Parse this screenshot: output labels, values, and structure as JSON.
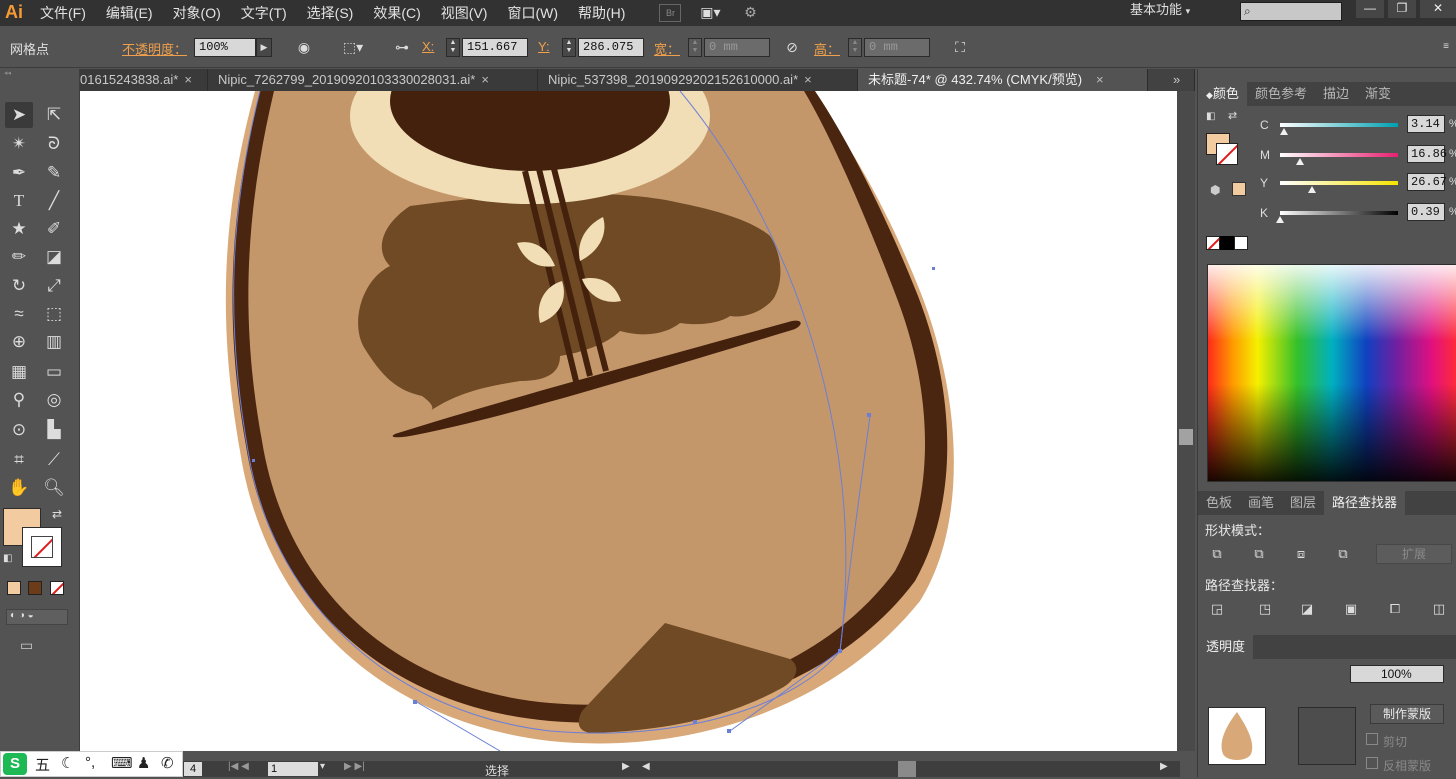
{
  "app": {
    "logo": "Ai"
  },
  "menu": [
    "文件(F)",
    "编辑(E)",
    "对象(O)",
    "文字(T)",
    "选择(S)",
    "效果(C)",
    "视图(V)",
    "窗口(W)",
    "帮助(H)"
  ],
  "menu_icons": {
    "bridge": "Br"
  },
  "workspace": "基本功能",
  "control": {
    "selection_type": "网格点",
    "opacity_label": "不透明度：",
    "opacity_value": "100%",
    "x_label": "X:",
    "x_value": "151.667 m",
    "y_label": "Y:",
    "y_value": "286.075 m",
    "w_label": "宽：",
    "w_value": "0 mm",
    "h_label": "高：",
    "h_value": "0 mm"
  },
  "tabs": [
    {
      "label": "01615243838.ai*",
      "close": "×",
      "active": false
    },
    {
      "label": "Nipic_7262799_20190920103330028031.ai*",
      "close": "×",
      "active": false
    },
    {
      "label": "Nipic_537398_20190929202152610000.ai*",
      "close": "×",
      "active": false
    },
    {
      "label": "未标题-74* @ 432.74% (CMYK/预览)",
      "close": "×",
      "active": true
    }
  ],
  "tabs_overflow": "»",
  "color_panel": {
    "tabs": [
      "颜色",
      "颜色参考",
      "描边",
      "渐变"
    ],
    "channels": [
      {
        "label": "C",
        "value": "3.14",
        "fraction": 0.03,
        "gradient": "linear-gradient(90deg,#ffffff,#00a0b0)"
      },
      {
        "label": "M",
        "value": "16.86",
        "fraction": 0.17,
        "gradient": "linear-gradient(90deg,#ffffff,#e8206f)"
      },
      {
        "label": "Y",
        "value": "26.67",
        "fraction": 0.27,
        "gradient": "linear-gradient(90deg,#ffffff,#f5e400)"
      },
      {
        "label": "K",
        "value": "0.39",
        "fraction": 0.004,
        "gradient": "linear-gradient(90deg,#ffffff,#000000)"
      }
    ],
    "percent": "%",
    "fill_color": "#f2cba0"
  },
  "pathfinder": {
    "tabs": [
      "色板",
      "画笔",
      "图层",
      "路径查找器"
    ],
    "shape_modes_label": "形状模式：",
    "expand_label": "扩展",
    "pathfinders_label": "路径查找器："
  },
  "transparency": {
    "tab": "透明度",
    "opacity": "100%",
    "make_mask": "制作蒙版",
    "clip": "剪切",
    "invert": "反相蒙版"
  },
  "status": {
    "zoom": "4",
    "page": "1",
    "tool": "选择"
  },
  "ime": {
    "logo": "S",
    "mode": "五"
  },
  "colors": {
    "body_outline": "#4a2510",
    "body_fill": "#c4976b",
    "body_rim": "#d9a878",
    "soundhole_ring": "#f1ddb6",
    "dark_brown": "#44210d",
    "medium_brown": "#6f4a24",
    "flower": "#f1ddb6",
    "path_line": "#6b7fd6"
  }
}
